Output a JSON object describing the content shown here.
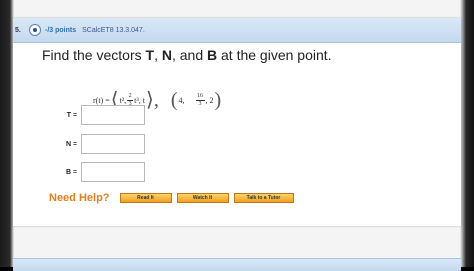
{
  "question": {
    "number": "5.",
    "points": "-/3 points",
    "reference": "SCalcET8 13.3.047.",
    "prompt_prefix": "Find the vectors ",
    "vec_T": "T",
    "sep1": ", ",
    "vec_N": "N",
    "sep2": ", and ",
    "vec_B": "B",
    "prompt_suffix": " at the given point."
  },
  "formula": {
    "lhs": "r(t) =",
    "t_squared": "t²,",
    "coef_num": "2",
    "coef_den": "3",
    "t_cubed": "t³, t",
    "point_x": "4,",
    "point_y_num": "16",
    "point_y_den": "3",
    "point_z": ", 2"
  },
  "answers": [
    {
      "label": "T",
      "eq": "=",
      "value": ""
    },
    {
      "label": "N",
      "eq": "=",
      "value": ""
    },
    {
      "label": "B",
      "eq": "=",
      "value": ""
    }
  ],
  "help": {
    "label": "Need Help?",
    "read": "Read It",
    "watch": "Watch It",
    "tutor": "Talk to a Tutor"
  },
  "colors": {
    "header_bg": "#c4d9ef",
    "help_orange": "#e07f1e",
    "button_gold": "#f0a020"
  }
}
